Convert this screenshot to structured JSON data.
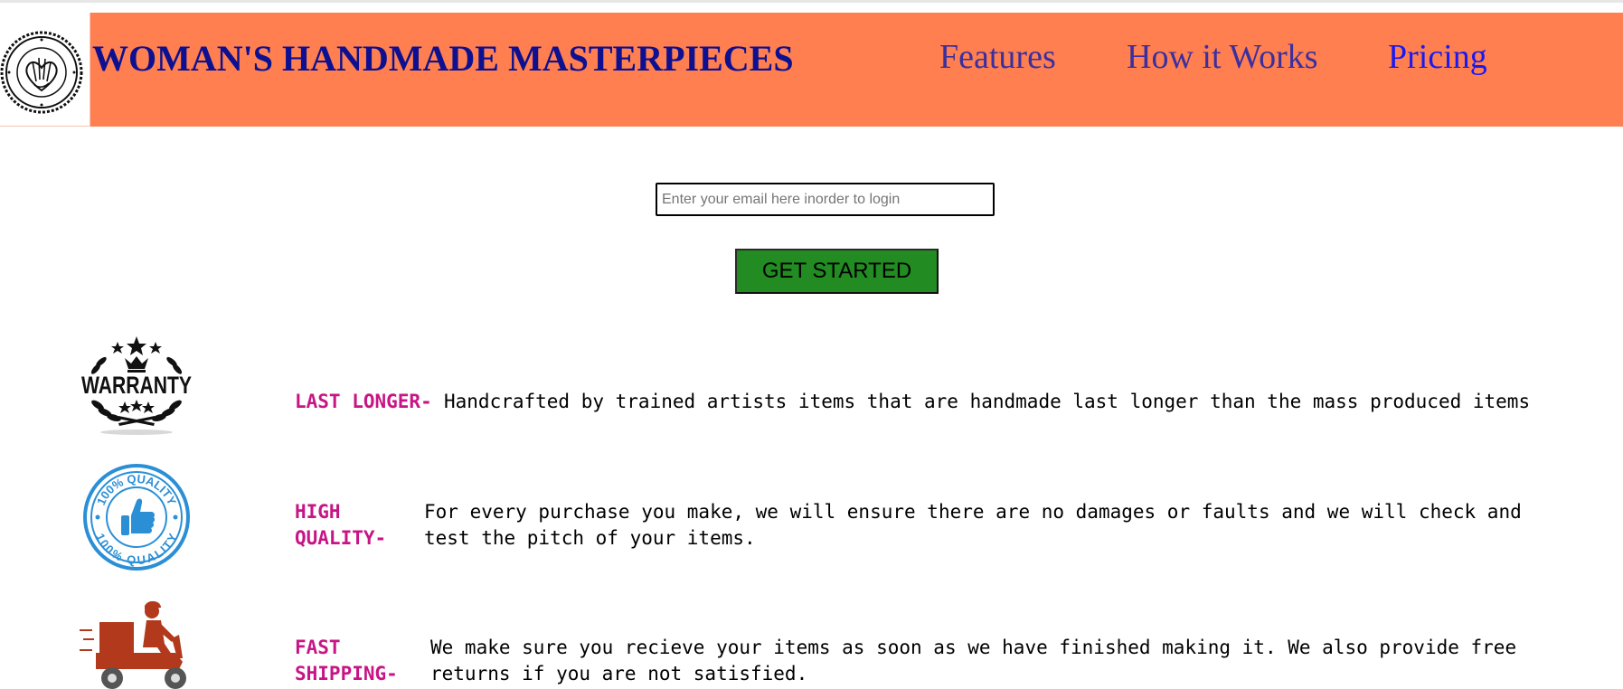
{
  "header": {
    "brand": "WOMAN'S HANDMADE MASTERPIECES",
    "logo_icon": "handmade-stamp-logo",
    "nav": {
      "features": "Features",
      "how_it_works": "How it Works",
      "pricing": "Pricing"
    },
    "background_color": "#ff7f50"
  },
  "login": {
    "email_placeholder": "Enter your email here inorder to login",
    "email_value": "",
    "button_label": "GET STARTED",
    "button_color": "#228b22"
  },
  "features": [
    {
      "icon": "warranty-badge-icon",
      "label": "LAST LONGER-",
      "lines": [
        "Handcrafted by trained artists items that are handmade last longer than the mass produced items"
      ]
    },
    {
      "icon": "quality-thumbs-up-icon",
      "label": "HIGH QUALITY-",
      "lines": [
        "For every purchase you make, we will ensure there are no damages or faults and we will check and",
        "test the pitch of your items."
      ]
    },
    {
      "icon": "delivery-scooter-icon",
      "label": "FAST SHIPPING-",
      "lines": [
        "We make sure you recieve your items as soon as we have finished making it. We also provide free",
        "returns if you are not satisfied."
      ]
    }
  ],
  "colors": {
    "brand_text": "#0d1090",
    "feature_label": "#c71585"
  }
}
